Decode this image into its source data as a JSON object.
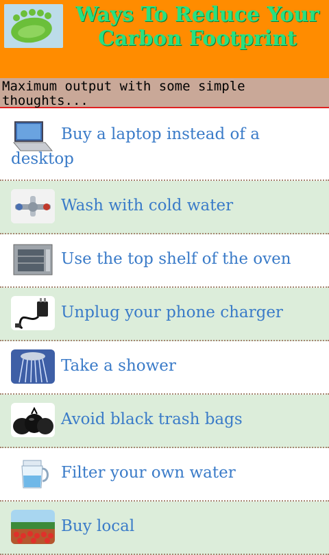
{
  "header": {
    "title": "Ways To Reduce Your Carbon Footprint",
    "logo_icon": "footprint-icon",
    "background": "#ff8c00",
    "title_color": "#28e080"
  },
  "subtitle": "Maximum output with some simple thoughts...",
  "list": {
    "items": [
      {
        "label": "Buy a laptop instead of a desktop",
        "icon": "laptop-icon"
      },
      {
        "label": "Wash with cold water",
        "icon": "faucet-icon"
      },
      {
        "label": "Use the top shelf of the oven",
        "icon": "oven-icon"
      },
      {
        "label": "Unplug your phone charger",
        "icon": "charger-icon"
      },
      {
        "label": "Take a shower",
        "icon": "shower-icon"
      },
      {
        "label": "Avoid black trash bags",
        "icon": "trash-bags-icon"
      },
      {
        "label": "Filter your own water",
        "icon": "water-filter-icon"
      },
      {
        "label": "Buy local",
        "icon": "produce-market-icon"
      }
    ],
    "alt_row_color": "#dcedda",
    "label_color": "#3a7bc8"
  }
}
